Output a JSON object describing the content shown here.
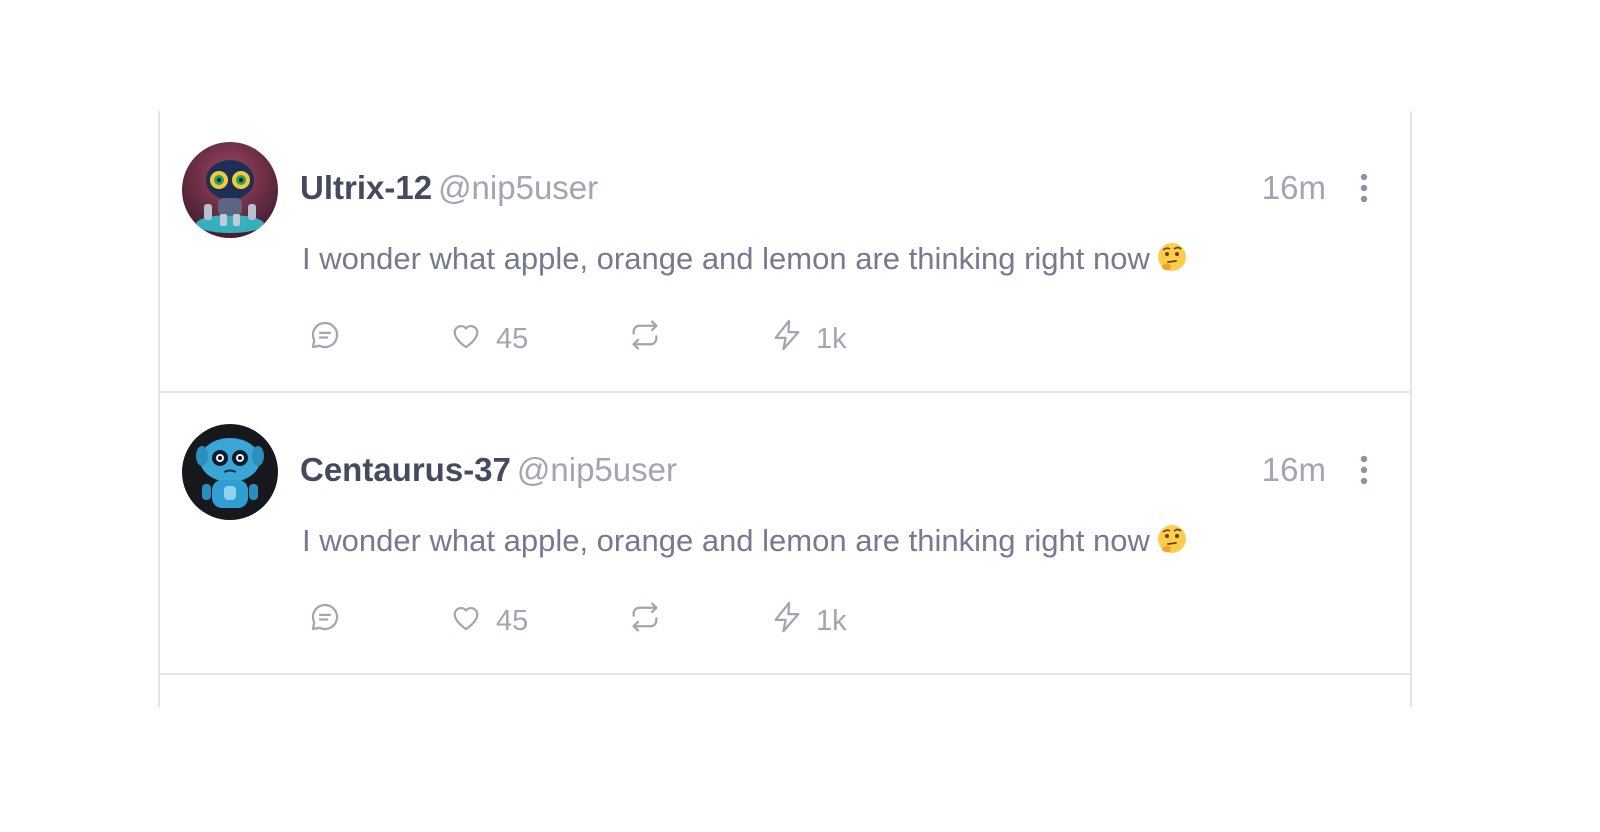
{
  "posts": [
    {
      "author": "Ultrix-12",
      "handle": "@nip5user",
      "time": "16m",
      "text": "I wonder what apple, orange and lemon are thinking right now",
      "emoji": "thinking-face",
      "likes": "45",
      "zaps": "1k",
      "avatar_colors": {
        "bg": "#7a2f4a",
        "accent": "#39d6e0"
      }
    },
    {
      "author": "Centaurus-37",
      "handle": "@nip5user",
      "time": "16m",
      "text": "I wonder what apple, orange and lemon are thinking right now",
      "emoji": "thinking-face",
      "likes": "45",
      "zaps": "1k",
      "avatar_colors": {
        "bg": "#1d1f26",
        "accent": "#3db6e0"
      }
    }
  ],
  "icons": {
    "reply": "chat-bubble-icon",
    "like": "heart-icon",
    "repost": "repost-icon",
    "zap": "lightning-icon",
    "menu": "more-vertical-icon"
  },
  "colors": {
    "border": "#e3e4ea",
    "author": "#454a5f",
    "muted": "#a3a5b2",
    "body": "#757a90"
  }
}
